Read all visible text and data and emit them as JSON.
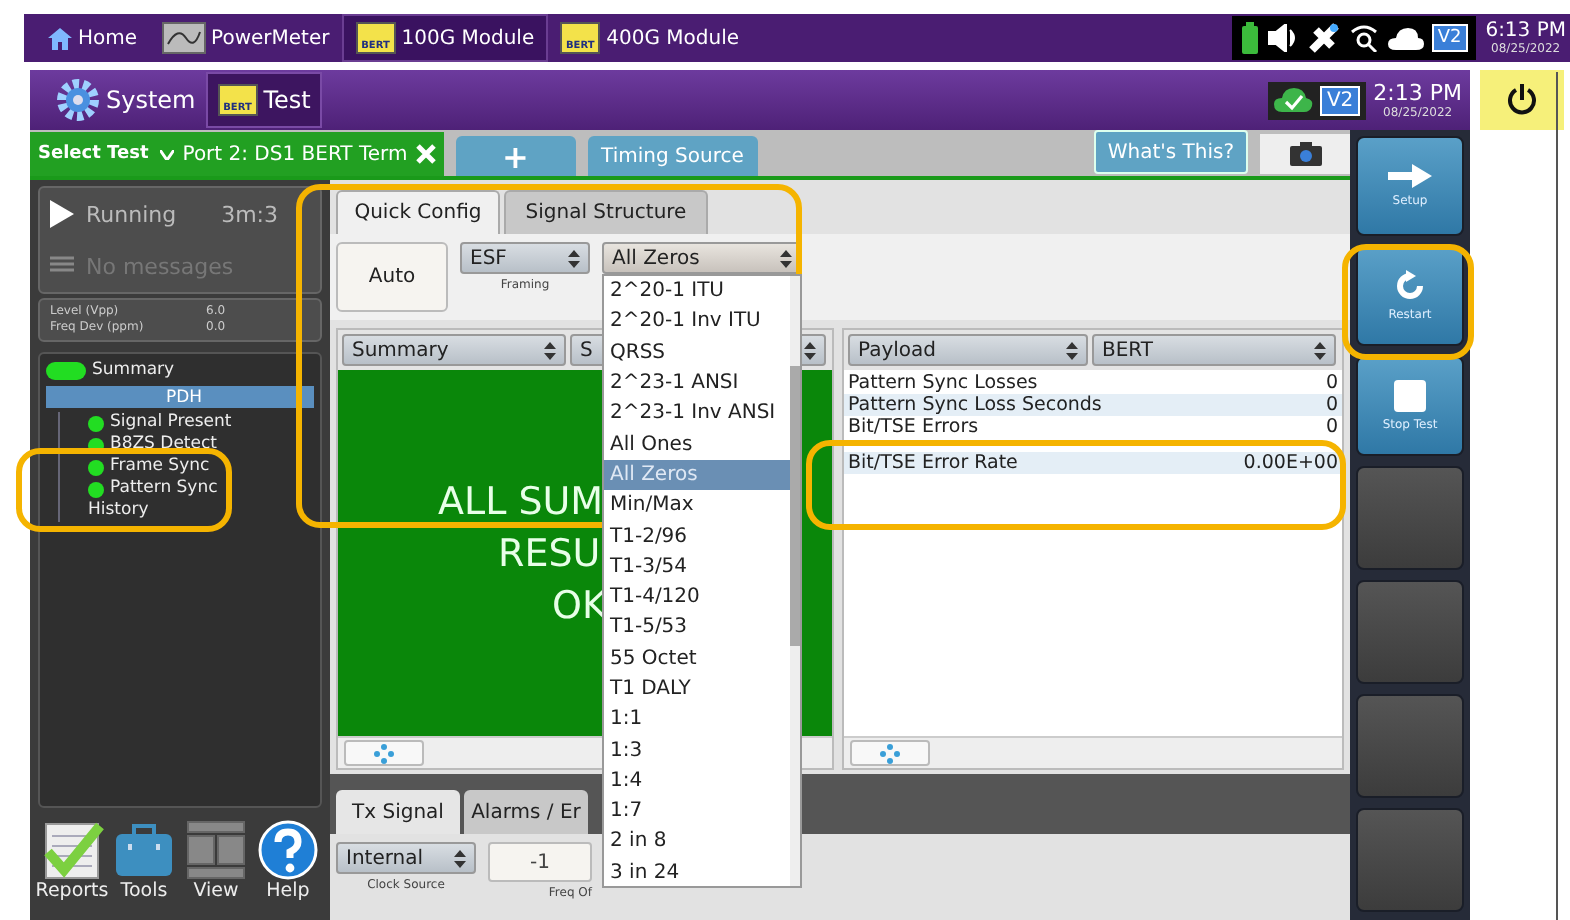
{
  "status_bar": {
    "tabs": [
      {
        "label": "Home",
        "kind": "home",
        "selected": false
      },
      {
        "label": "PowerMeter",
        "kind": "meter",
        "selected": false
      },
      {
        "label": "100G Module",
        "kind": "bert",
        "icon_label": "BERT",
        "selected": true
      },
      {
        "label": "400G Module",
        "kind": "bert",
        "icon_label": "BERT",
        "selected": false
      }
    ],
    "badge": "V2",
    "time": "6:13 PM",
    "date": "08/25/2022"
  },
  "app_bar": {
    "menus": [
      {
        "label": "System",
        "kind": "gear"
      },
      {
        "label": "Test",
        "kind": "bert",
        "icon_label": "BERT"
      }
    ],
    "badge": "V2",
    "time": "2:13 PM",
    "date": "08/25/2022"
  },
  "test_tabs": {
    "select_label": "Select Test",
    "tabs": [
      {
        "label": "Port 2: DS1 BERT Term",
        "kind": "port",
        "selected": true
      },
      {
        "label": "+",
        "kind": "add",
        "selected": false
      },
      {
        "label": "Timing Source",
        "kind": "plain",
        "selected": false
      }
    ],
    "help_button": "What's This?"
  },
  "status_panel": {
    "state": "Running",
    "elapsed": "3m:3",
    "message": "No messages",
    "readings": [
      {
        "label": "Level (Vpp)",
        "value": "6.0"
      },
      {
        "label": "Freq Dev (ppm)",
        "value": "0.0"
      }
    ]
  },
  "tree": [
    {
      "label": "Summary",
      "kind": "summary",
      "color": "#22dd22"
    },
    {
      "label": "PDH",
      "kind": "group",
      "selected": true,
      "children": [
        {
          "label": "Signal Present",
          "kind": "status",
          "color": "#22dd22"
        },
        {
          "label": "B8ZS Detect",
          "kind": "status",
          "color": "#22dd22"
        },
        {
          "label": "Frame Sync",
          "kind": "status",
          "color": "#22dd22"
        },
        {
          "label": "Pattern Sync",
          "kind": "status",
          "color": "#22dd22"
        },
        {
          "label": "History",
          "kind": "plain"
        }
      ]
    }
  ],
  "tools": [
    {
      "label": "Reports",
      "kind": "reports"
    },
    {
      "label": "Tools",
      "kind": "tools"
    },
    {
      "label": "View",
      "kind": "view"
    },
    {
      "label": "Help",
      "kind": "help"
    }
  ],
  "quick_config": {
    "tabs": [
      {
        "label": "Quick Config",
        "selected": true
      },
      {
        "label": "Signal Structure",
        "selected": false
      }
    ],
    "auto_button": "Auto",
    "framing": {
      "value": "ESF",
      "label": "Framing"
    },
    "pattern": {
      "value": "All Zeros",
      "expanded": true
    },
    "pattern_options": [
      {
        "label": "2^20-1 ITU",
        "selected": false
      },
      {
        "label": "2^20-1 Inv ITU",
        "selected": false
      },
      {
        "label": "QRSS",
        "selected": false
      },
      {
        "label": "2^23-1 ANSI",
        "selected": false
      },
      {
        "label": "2^23-1 Inv ANSI",
        "selected": false
      },
      {
        "label": "All Ones",
        "selected": false
      },
      {
        "label": "All Zeros",
        "selected": true
      },
      {
        "label": "Min/Max",
        "selected": false
      },
      {
        "label": "T1-2/96",
        "selected": false
      },
      {
        "label": "T1-3/54",
        "selected": false
      },
      {
        "label": "T1-4/120",
        "selected": false
      },
      {
        "label": "T1-5/53",
        "selected": false
      },
      {
        "label": "55 Octet",
        "selected": false
      },
      {
        "label": "T1 DALY",
        "selected": false
      },
      {
        "label": "1:1",
        "selected": false
      },
      {
        "label": "1:3",
        "selected": false
      },
      {
        "label": "1:4",
        "selected": false
      },
      {
        "label": "1:7",
        "selected": false
      },
      {
        "label": "2 in 8",
        "selected": false
      },
      {
        "label": "3 in 24",
        "selected": false
      }
    ]
  },
  "summary_pane": {
    "selects": [
      "Summary",
      "S"
    ],
    "message_lines": [
      "ALL SUM",
      "RESU",
      "OK"
    ]
  },
  "payload_pane": {
    "selects": [
      "Payload",
      "BERT"
    ],
    "rows": [
      {
        "name": "Pattern Sync Losses",
        "value": "0"
      },
      {
        "name": "Pattern Sync Loss Seconds",
        "value": "0"
      },
      {
        "name": "Bit/TSE Errors",
        "value": "0"
      },
      {
        "name": "Bit/TSE Error Rate",
        "value": "0.00E+00"
      }
    ]
  },
  "bottom": {
    "tabs": [
      {
        "label": "Tx Signal",
        "selected": true
      },
      {
        "label": "Alarms / Er",
        "selected": false
      }
    ],
    "clock_source": {
      "value": "Internal",
      "label": "Clock Source"
    },
    "step_button": "-1",
    "freq_label": "Freq Of"
  },
  "actions": [
    {
      "label": "Setup",
      "kind": "arrow"
    },
    {
      "label": "Restart",
      "kind": "restart"
    },
    {
      "label": "Stop Test",
      "kind": "stop"
    },
    {
      "kind": "empty"
    },
    {
      "kind": "empty"
    },
    {
      "kind": "empty"
    },
    {
      "kind": "empty"
    }
  ]
}
